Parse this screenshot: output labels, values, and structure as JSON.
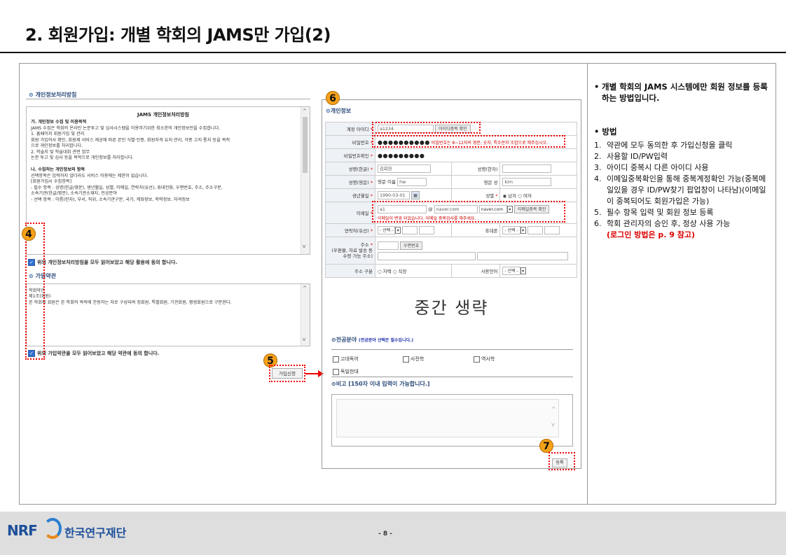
{
  "slide": {
    "title": "2. 회원가입: 개별 학회의 JAMS만 가입(2)",
    "page_number": "- 8 -"
  },
  "terms_panel": {
    "privacy_section_title": "개인정보처리방침",
    "privacy_box_title": "JAMS 개인정보처리방침",
    "privacy_lines": [
      {
        "text": "가. 개인정보 수집 및 이용목적",
        "bold": true
      },
      {
        "text": "  JAMS 수집은 학회의 온라인 논문투고 및 심사시스템을 이용하기위한 최소한의 개인정보만을 수집합니다.",
        "bold": false
      },
      {
        "text": "  1. 홈페이지 회원가입 및 관리",
        "bold": false
      },
      {
        "text": "  회원 가입의사 확인, 회원제 서비스 제공에 따른 본인 식별·인증, 회원자격 유지·관리, 각종 고지·통지 등을 목적",
        "bold": false
      },
      {
        "text": "  으로 개인정보를 처리합니다.",
        "bold": false
      },
      {
        "text": "  2. 학술지 및 학술대회 관련 업무",
        "bold": false
      },
      {
        "text": "  논문 투고 및 심사 등을 목적으로 개인정보를 처리합니다.",
        "bold": false
      },
      {
        "text": "",
        "bold": false
      },
      {
        "text": "나. 수집하는 개인정보의 항목",
        "bold": true
      },
      {
        "text": "  선택항목은 입력하지 않더라도 서비스 이용에는 제한이 없습니다.",
        "bold": false
      },
      {
        "text": "  [회원가입시 수집항목]",
        "bold": false
      },
      {
        "text": "  - 필수 항목 : 성명(한글/영문), 생년월일, 성별, 이메일, 연락처(유선), 휴대전화, 우편번호, 주소, 주소구분,",
        "bold": false
      },
      {
        "text": "                    소속기관(한글/영문), 소속기관소재지, 전공분야",
        "bold": false
      },
      {
        "text": "  - 선택 항목 : 이름(한자), 부서, 직위, 소속기관구분, 국가, 계좌정보, 학력정보, 자격정보",
        "bold": false
      }
    ],
    "privacy_agree": "위의 개인정보처리방침을 모두 읽어보았고 해당 활용에 동의 합니다.",
    "terms_section_title": "가입약관",
    "terms_lines": [
      "학회약관",
      "제1조(회원)",
      "본 학회의 회원은 본 학회의 목적에 찬동하는 자로 구성되며 정회원, 특별회원, 기관회원, 평생회원으로 구분한다."
    ],
    "terms_agree": "위의 가입약관을 모두 읽어보았고 해당 약관에 동의 합니다.",
    "apply_button": "가입신청"
  },
  "badges": {
    "b4": "4",
    "b5": "5",
    "b6": "6",
    "b7": "7"
  },
  "form_panel": {
    "section_title": "개인정보",
    "labels": {
      "account_id": "계정 아이디",
      "password": "비밀번호",
      "password_confirm": "비밀번호확인",
      "name_kr": "성명(한글)",
      "name_hanja": "성명(한자)",
      "name_en": "성명(영문)",
      "birth": "생년월일",
      "gender": "성별",
      "email": "이메일",
      "phone": "연락처(유선)",
      "mobile": "휴대폰",
      "address": "주소",
      "address_sub": "(우편물, 자료 발송 등",
      "address_sub2": "수령 가능 주소)",
      "address_type": "주소 구분",
      "language": "사용언어"
    },
    "values": {
      "account_id": "a1234",
      "password_mask": "●●●●●●●●●●",
      "password_confirm_mask": "●●●●●●●●●",
      "name_kr": "김회원",
      "first_name_label": "영문 이름",
      "first_name": "hw",
      "last_name_label": "영문 성",
      "last_name": "kim",
      "birth": "1990-03-01",
      "gender_male": "남자",
      "gender_female": "여자",
      "email_local": "a1",
      "email_at": "@",
      "email_domain": "naver.com",
      "email_select": "naver.com",
      "select_default": "- 선택 -",
      "address_home": "자택",
      "address_work": "직장"
    },
    "buttons": {
      "id_check": "아이디중복 확인",
      "email_check": "이메일중복 확인",
      "zipcode": "우편번호"
    },
    "hints": {
      "password_rule": "비밀번호는 8~12자의 영문, 숫자, 특수문자 조합으로 해주십시오.",
      "email_changed": "이메일이 변경 되었습니다. 이메일 중복검사를 해주세요."
    },
    "omitted_text": "중간 생략",
    "major_section_title": "전공분야",
    "major_required_note": "(전공분야 선택은 필수입니다.)",
    "majors": [
      "고대독어",
      "사전학",
      "역사학",
      "독일현대"
    ],
    "note_section_title": "비고 [150자 이내 입력이 가능합니다.]",
    "register_button": "등록"
  },
  "description_panel": {
    "intro": "개별 학회의 JAMS 시스템에만 회원 정보를 등록하는 방법입니다.",
    "method_title": "방법",
    "steps": [
      {
        "num": "1.",
        "text": "약관에 모두 동의한 후 가입신청을 클릭"
      },
      {
        "num": "2.",
        "text": "사용할 ID/PW입력"
      },
      {
        "num": "3.",
        "text": "아이디 중복시 다른 아이디 사용"
      },
      {
        "num": "4.",
        "text": "이메일중복확인을 통해 중복계정확인 가능(중복메일있을 경우 ID/PW찾기 팝업창이 나타남)(이메일이 중복되어도 회원가입은 가능)"
      },
      {
        "num": "5.",
        "text": "필수 항목 입력 및 회원 정보 등록"
      },
      {
        "num": "6.",
        "text": "학회 관리자의 승인 후, 정상 사용 가능"
      }
    ],
    "step6_note": "(로그인 방법은 p. 9 참고)"
  },
  "footer": {
    "logo_text": "NRF",
    "org_name": "한국연구재단"
  }
}
